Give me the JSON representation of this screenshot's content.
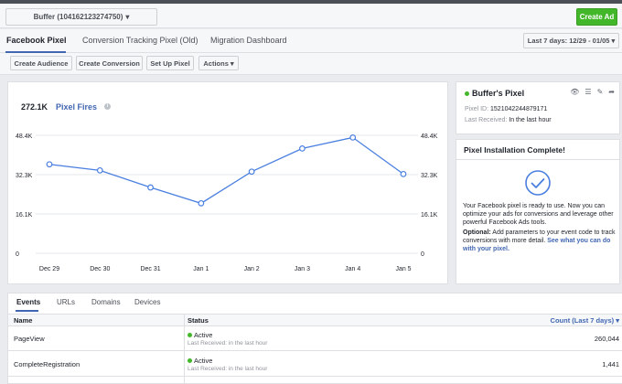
{
  "topbar": {
    "account_label": "Buffer (104162123274750)",
    "create_ad_label": "Create Ad"
  },
  "tabs": [
    {
      "label": "Facebook Pixel",
      "active": true
    },
    {
      "label": "Conversion Tracking Pixel (Old)",
      "active": false
    },
    {
      "label": "Migration Dashboard",
      "active": false
    }
  ],
  "date_range": "Last 7 days: 12/29 - 01/05",
  "actions": {
    "create_audience": "Create Audience",
    "create_conversion": "Create Conversion",
    "set_up_pixel": "Set Up Pixel",
    "actions_menu": "Actions"
  },
  "summary": {
    "total": "272.1K",
    "label": "Pixel Fires"
  },
  "chart_data": {
    "type": "line",
    "categories": [
      "Dec 29",
      "Dec 30",
      "Dec 31",
      "Jan 1",
      "Jan 2",
      "Jan 3",
      "Jan 4",
      "Jan 5"
    ],
    "series": [
      {
        "values": [
          36500,
          34000,
          27000,
          20500,
          33500,
          43000,
          47500,
          32500
        ]
      }
    ],
    "ylim": [
      0,
      48400
    ],
    "yticks": [
      "0",
      "16.1K",
      "32.3K",
      "48.4K"
    ],
    "line_color": "#4a7fe0"
  },
  "pixel_card": {
    "name": "Buffer's Pixel",
    "id_label": "Pixel ID:",
    "id_value": "1521042244879171",
    "received_label": "Last Received:",
    "received_value": "In the last hour"
  },
  "install_card": {
    "title": "Pixel Installation Complete!",
    "body": "Your Facebook pixel is ready to use. Now you can optimize your ads for conversions and leverage other powerful Facebook Ads tools.",
    "optional_label": "Optional:",
    "optional_body": "Add parameters to your event code to track conversions with more detail.",
    "link": "See what you can do with your pixel."
  },
  "bottom_tabs": [
    {
      "label": "Events",
      "active": true
    },
    {
      "label": "URLs",
      "active": false
    },
    {
      "label": "Domains",
      "active": false
    },
    {
      "label": "Devices",
      "active": false
    }
  ],
  "table": {
    "headers": {
      "name": "Name",
      "status": "Status",
      "count": "Count (Last 7 days)"
    },
    "rows": [
      {
        "name": "PageView",
        "status": "Active",
        "sub": "Last Received: in the last hour",
        "count": "260,044"
      },
      {
        "name": "CompleteRegistration",
        "status": "Active",
        "sub": "Last Received: in the last hour",
        "count": "1,441"
      }
    ]
  }
}
